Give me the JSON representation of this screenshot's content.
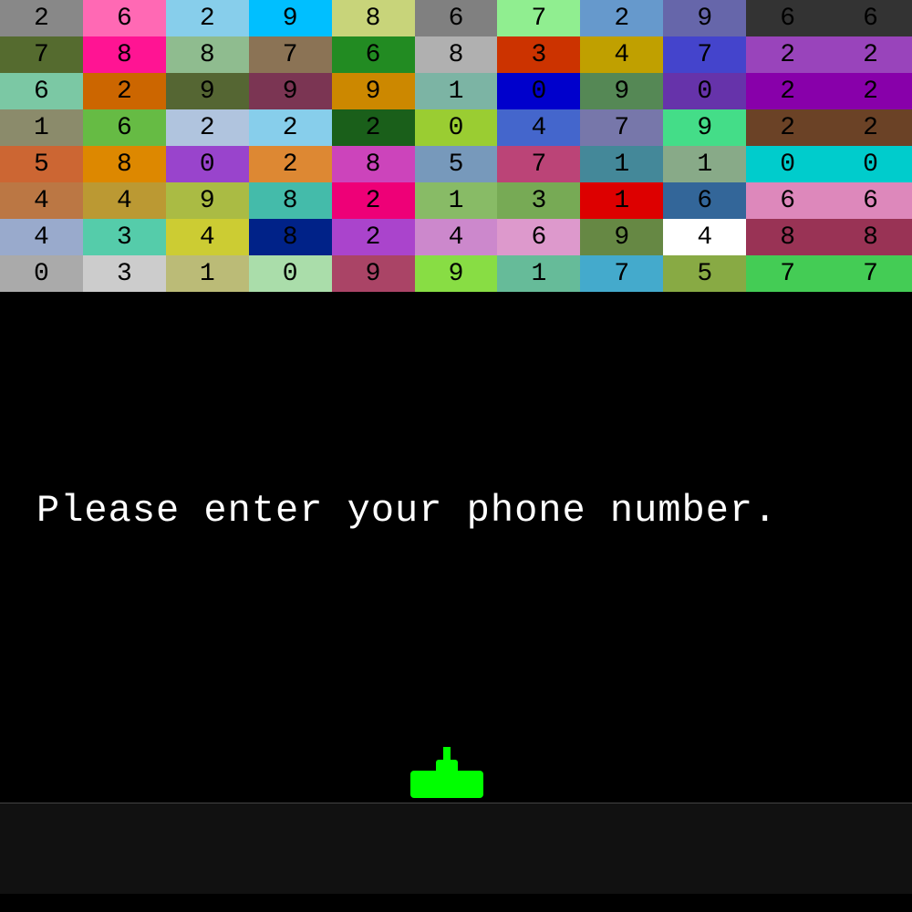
{
  "grid": {
    "rows": [
      [
        {
          "value": "2",
          "bg": "#888888"
        },
        {
          "value": "6",
          "bg": "#ff69b4"
        },
        {
          "value": "2",
          "bg": "#87ceeb"
        },
        {
          "value": "9",
          "bg": "#00bfff"
        },
        {
          "value": "8",
          "bg": "#c8d47a"
        },
        {
          "value": "6",
          "bg": "#808080"
        },
        {
          "value": "7",
          "bg": "#90ee90"
        },
        {
          "value": "2",
          "bg": "#6699cc"
        },
        {
          "value": "9",
          "bg": "#6666aa"
        },
        {
          "value": "6",
          "bg": "#333333"
        },
        {
          "value": "6",
          "bg": "#333333"
        }
      ],
      [
        {
          "value": "7",
          "bg": "#556b2f"
        },
        {
          "value": "8",
          "bg": "#ff1493"
        },
        {
          "value": "8",
          "bg": "#8fbc8f"
        },
        {
          "value": "7",
          "bg": "#8b7355"
        },
        {
          "value": "6",
          "bg": "#228b22"
        },
        {
          "value": "8",
          "bg": "#b0b0b0"
        },
        {
          "value": "3",
          "bg": "#cc3300"
        },
        {
          "value": "4",
          "bg": "#c0a000"
        },
        {
          "value": "7",
          "bg": "#4444cc"
        },
        {
          "value": "2",
          "bg": "#9944bb"
        },
        {
          "value": "2",
          "bg": "#9944bb"
        }
      ],
      [
        {
          "value": "6",
          "bg": "#7bc8a4"
        },
        {
          "value": "2",
          "bg": "#cc6600"
        },
        {
          "value": "9",
          "bg": "#556633"
        },
        {
          "value": "9",
          "bg": "#7b3553"
        },
        {
          "value": "9",
          "bg": "#cc8800"
        },
        {
          "value": "1",
          "bg": "#7cb4a4"
        },
        {
          "value": "0",
          "bg": "#0000cc"
        },
        {
          "value": "9",
          "bg": "#558855"
        },
        {
          "value": "0",
          "bg": "#6633aa"
        },
        {
          "value": "2",
          "bg": "#8800aa"
        },
        {
          "value": "2",
          "bg": "#8800aa"
        }
      ],
      [
        {
          "value": "1",
          "bg": "#8b8b6b"
        },
        {
          "value": "6",
          "bg": "#66bb44"
        },
        {
          "value": "2",
          "bg": "#b0c4de"
        },
        {
          "value": "2",
          "bg": "#87ceeb"
        },
        {
          "value": "2",
          "bg": "#1a5f1a"
        },
        {
          "value": "0",
          "bg": "#9acd32"
        },
        {
          "value": "4",
          "bg": "#4466cc"
        },
        {
          "value": "7",
          "bg": "#7777aa"
        },
        {
          "value": "9",
          "bg": "#44dd88"
        },
        {
          "value": "2",
          "bg": "#6b4226"
        },
        {
          "value": "2",
          "bg": "#6b4226"
        }
      ],
      [
        {
          "value": "5",
          "bg": "#cc6633"
        },
        {
          "value": "8",
          "bg": "#dd8800"
        },
        {
          "value": "0",
          "bg": "#9944cc"
        },
        {
          "value": "2",
          "bg": "#dd8833"
        },
        {
          "value": "8",
          "bg": "#cc44bb"
        },
        {
          "value": "5",
          "bg": "#7799bb"
        },
        {
          "value": "7",
          "bg": "#bb4477"
        },
        {
          "value": "1",
          "bg": "#448899"
        },
        {
          "value": "1",
          "bg": "#88aa88"
        },
        {
          "value": "0",
          "bg": "#00cccc"
        },
        {
          "value": "0",
          "bg": "#00cccc"
        }
      ],
      [
        {
          "value": "4",
          "bg": "#bb7744"
        },
        {
          "value": "4",
          "bg": "#bb9933"
        },
        {
          "value": "9",
          "bg": "#aabb44"
        },
        {
          "value": "8",
          "bg": "#44bbaa"
        },
        {
          "value": "2",
          "bg": "#ee0077"
        },
        {
          "value": "1",
          "bg": "#88bb66"
        },
        {
          "value": "3",
          "bg": "#77aa55"
        },
        {
          "value": "1",
          "bg": "#dd0000"
        },
        {
          "value": "6",
          "bg": "#336699"
        },
        {
          "value": "6",
          "bg": "#dd88bb"
        },
        {
          "value": "6",
          "bg": "#dd88bb"
        }
      ],
      [
        {
          "value": "4",
          "bg": "#99aacc"
        },
        {
          "value": "3",
          "bg": "#55ccaa"
        },
        {
          "value": "4",
          "bg": "#cccc33"
        },
        {
          "value": "8",
          "bg": "#002288"
        },
        {
          "value": "2",
          "bg": "#aa44cc"
        },
        {
          "value": "4",
          "bg": "#cc88cc"
        },
        {
          "value": "6",
          "bg": "#dd99cc"
        },
        {
          "value": "9",
          "bg": "#668844"
        },
        {
          "value": "4",
          "bg": "#ffffff"
        },
        {
          "value": "8",
          "bg": "#993355"
        },
        {
          "value": "8",
          "bg": "#993355"
        }
      ],
      [
        {
          "value": "0",
          "bg": "#aaaaaa"
        },
        {
          "value": "3",
          "bg": "#cccccc"
        },
        {
          "value": "1",
          "bg": "#bbbb77"
        },
        {
          "value": "0",
          "bg": "#aaddaa"
        },
        {
          "value": "9",
          "bg": "#aa4466"
        },
        {
          "value": "9",
          "bg": "#88dd44"
        },
        {
          "value": "1",
          "bg": "#66bb99"
        },
        {
          "value": "7",
          "bg": "#44aacc"
        },
        {
          "value": "5",
          "bg": "#88aa44"
        },
        {
          "value": "7",
          "bg": "#44cc55"
        },
        {
          "value": "7",
          "bg": "#44cc55"
        }
      ]
    ]
  },
  "prompt": {
    "text": "Please enter your phone number."
  },
  "input": {
    "placeholder": "",
    "value": ""
  }
}
